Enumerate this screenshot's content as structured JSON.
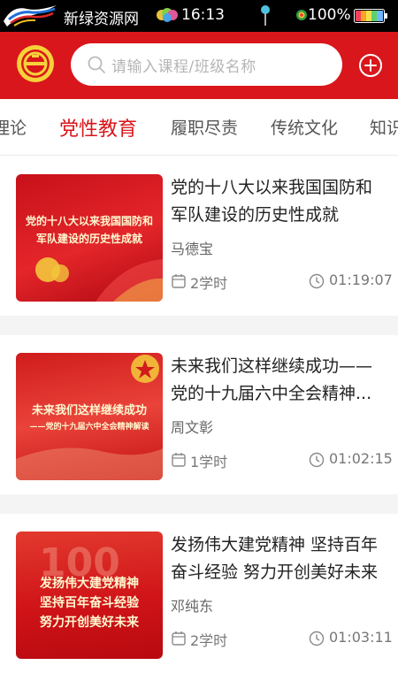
{
  "status_bar": {
    "source": "新绿资源网",
    "time": "16:13",
    "battery": "100%"
  },
  "header": {
    "search_placeholder": "请输入课程/班级名称"
  },
  "tabs": [
    {
      "label": "理论",
      "active": false
    },
    {
      "label": "党性教育",
      "active": true
    },
    {
      "label": "履职尽责",
      "active": false
    },
    {
      "label": "传统文化",
      "active": false
    },
    {
      "label": "知识",
      "active": false
    }
  ],
  "courses": [
    {
      "title": "党的十八大以来我国国防和军队建设的历史性成就",
      "thumb_text": [
        "党的十八大以来我国国防和",
        "军队建设的历史性成就"
      ],
      "author": "马德宝",
      "credits": "2学时",
      "duration": "01:19:07"
    },
    {
      "title": "未来我们这样继续成功——党的十九届六中全会精神...",
      "thumb_text": [
        "未来我们这样继续成功",
        "——党的十九届六中全会精神解读"
      ],
      "author": "周文彰",
      "credits": "1学时",
      "duration": "01:02:15"
    },
    {
      "title": "发扬伟大建党精神 坚持百年奋斗经验 努力开创美好未来",
      "thumb_text": [
        "发扬伟大建党精神",
        "坚持百年奋斗经验",
        "努力开创美好未来"
      ],
      "author": "邓纯东",
      "credits": "2学时",
      "duration": "01:03:11"
    }
  ]
}
